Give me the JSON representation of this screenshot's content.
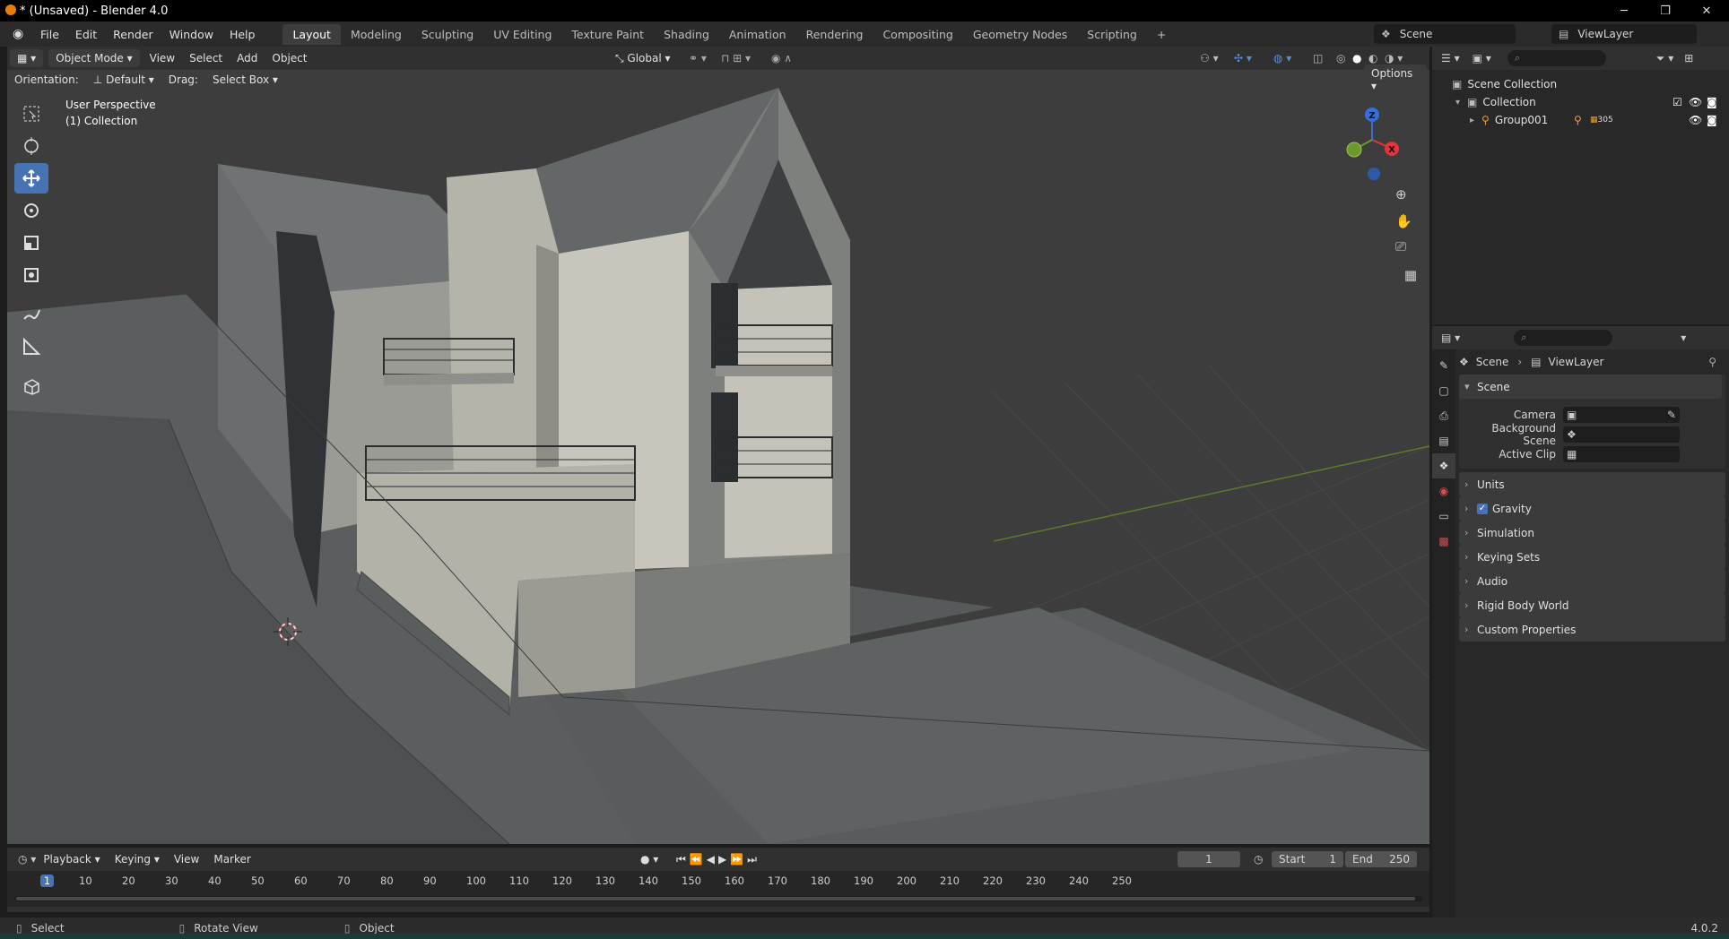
{
  "window": {
    "title": "* (Unsaved) - Blender 4.0",
    "controls": [
      "minimize",
      "maximize",
      "close"
    ]
  },
  "menubar": {
    "menus": [
      "File",
      "Edit",
      "Render",
      "Window",
      "Help"
    ],
    "workspaces": [
      "Layout",
      "Modeling",
      "Sculpting",
      "UV Editing",
      "Texture Paint",
      "Shading",
      "Animation",
      "Rendering",
      "Compositing",
      "Geometry Nodes",
      "Scripting"
    ],
    "active_workspace": "Layout",
    "add_workspace": "+",
    "scene_name": "Scene",
    "view_layer_name": "ViewLayer"
  },
  "viewport_header": {
    "mode": "Object Mode",
    "menus": [
      "View",
      "Select",
      "Add",
      "Object"
    ],
    "transform_orientation": "Global",
    "orientation_label": "Orientation:",
    "orientation_value": "Default",
    "drag_label": "Drag:",
    "drag_value": "Select Box",
    "options_label": "Options"
  },
  "viewport": {
    "perspective_text": "User Perspective",
    "collection_text": "(1) Collection",
    "gizmo_axes": [
      "Z",
      "X",
      "Y"
    ]
  },
  "outliner": {
    "items": [
      {
        "label": "Scene Collection",
        "icon": "collection-icon"
      },
      {
        "label": "Collection",
        "icon": "collection-icon"
      },
      {
        "label": "Group001",
        "icon": "empty-icon",
        "badge": "305"
      }
    ]
  },
  "properties": {
    "breadcrumb": [
      "Scene",
      "ViewLayer"
    ],
    "section_title": "Scene",
    "fields": [
      {
        "label": "Camera",
        "value": ""
      },
      {
        "label": "Background Scene",
        "value": ""
      },
      {
        "label": "Active Clip",
        "value": ""
      }
    ],
    "panels": [
      "Units",
      "Gravity",
      "Simulation",
      "Keying Sets",
      "Audio",
      "Rigid Body World",
      "Custom Properties"
    ],
    "gravity_checked": true
  },
  "timeline": {
    "menus": [
      "Playback",
      "Keying",
      "View",
      "Marker"
    ],
    "current_frame": "1",
    "start_label": "Start",
    "start_value": "1",
    "end_label": "End",
    "end_value": "250",
    "ruler_marks": [
      "1",
      "10",
      "20",
      "30",
      "40",
      "50",
      "60",
      "70",
      "80",
      "90",
      "100",
      "110",
      "120",
      "130",
      "140",
      "150",
      "160",
      "170",
      "180",
      "190",
      "200",
      "210",
      "220",
      "230",
      "240",
      "250"
    ]
  },
  "statusbar": {
    "items": [
      "Select",
      "Rotate View",
      "Object"
    ],
    "version": "4.0.2"
  },
  "colors": {
    "accent": "#4772b3",
    "x_axis": "#e0353d",
    "y_axis": "#6a9a2a",
    "z_axis": "#3470d8"
  }
}
